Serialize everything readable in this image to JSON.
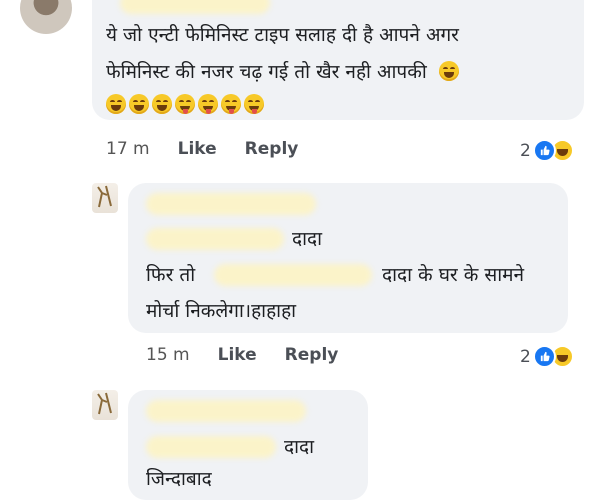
{
  "comment_main": {
    "line1": "ये जो एन्टी फेमिनिस्ट टाइप सलाह दी है आपने अगर",
    "line2": "फेमिनिस्ट की नजर चढ़ गई तो खैर नही आपकी",
    "time": "17 m",
    "like": "Like",
    "reply": "Reply",
    "reaction_count": "2"
  },
  "reply1": {
    "line1": "दादा",
    "line2_a": "फिर तो",
    "line2_b": "दादा के घर के सामने",
    "line3": "मोर्चा निकलेगा।हाहाहा",
    "time": "15 m",
    "like": "Like",
    "reply": "Reply",
    "reaction_count": "2"
  },
  "reply2": {
    "line1": "दादा",
    "line2": "जिन्दाबाद"
  },
  "icons": {
    "like": "thumbs-up-icon",
    "haha": "laughing-face-icon",
    "emoji_smile": "smiling-face-icon",
    "emoji_tongue": "face-with-tongue-icon"
  },
  "colors": {
    "bubble": "#f0f2f5",
    "like_blue": "#1877f2",
    "emoji_yellow": "#f7c928",
    "redaction": "#fbf3c9"
  }
}
